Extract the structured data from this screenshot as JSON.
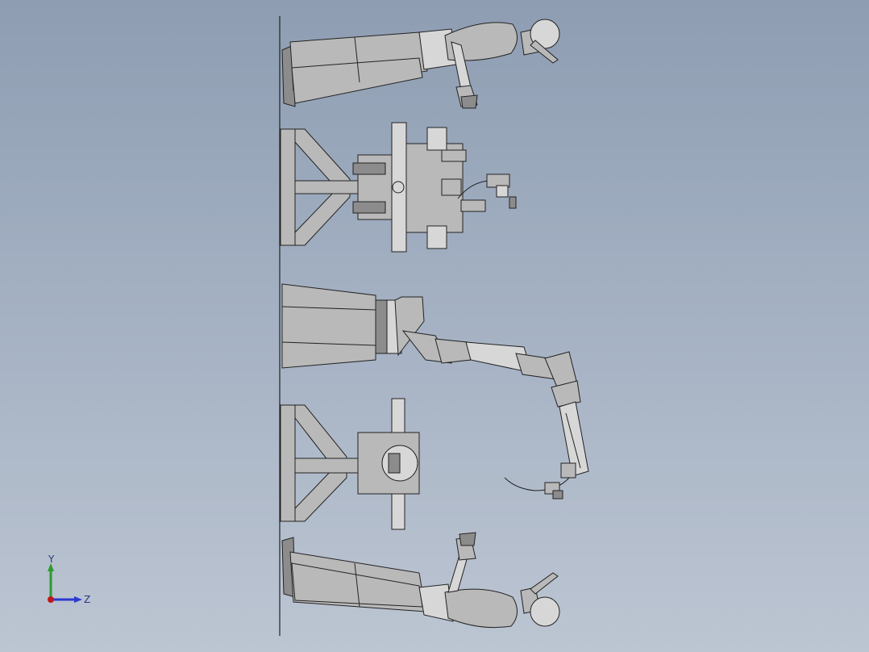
{
  "app": {
    "title": ""
  },
  "viewport": {
    "background_top": "#8e9db2",
    "background_bottom": "#bcc5d2",
    "model_color": "#b9b9b9",
    "edge_color": "#222222"
  },
  "triad": {
    "y_label": "Y",
    "z_label": "Z",
    "y_color": "#2e9b2e",
    "z_color": "#2b3ad0",
    "x_color": "#c01818"
  },
  "scene": {
    "parts": [
      "operator-top",
      "fixture-upper",
      "robot-base",
      "robot-arm",
      "fixture-lower",
      "operator-bottom"
    ]
  }
}
